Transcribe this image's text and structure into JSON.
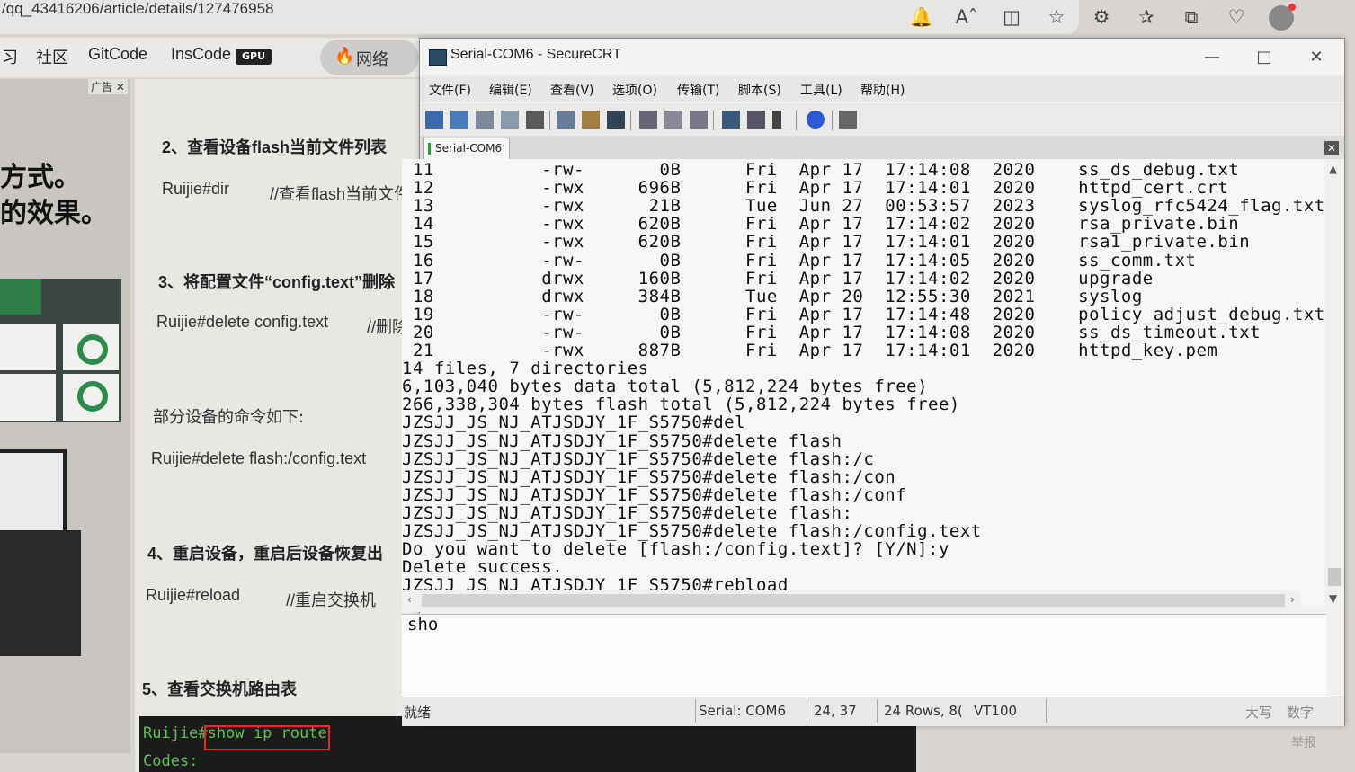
{
  "browser": {
    "url": "/qq_43416206/article/details/127476958",
    "icons": [
      "bell-icon",
      "read-aloud-icon",
      "split-screen-icon",
      "star-icon",
      "extensions-icon",
      "favorites-icon",
      "collections-icon",
      "health-icon",
      "profile-icon"
    ]
  },
  "nav": {
    "items": [
      "习",
      "社区",
      "GitCode",
      "InsCode"
    ],
    "gpu_badge": "GPU",
    "network": "网络"
  },
  "ad": {
    "tag": "广告",
    "close": "✕",
    "line1": "方式。",
    "line2": "的效果。"
  },
  "article": {
    "h2": "2、查看设备flash当前文件列表",
    "cmd_dir": "Ruijie#dir",
    "cmd_dir_comment": "//查看flash当前文件",
    "h3": "3、将配置文件“config.text”删除",
    "cmd_delete": "Ruijie#delete config.text",
    "cmd_delete_comment": "//删除",
    "note": "部分设备的命令如下:",
    "cmd_delete_flash": "Ruijie#delete flash:/config.text",
    "h4": "4、重启设备，重启后设备恢复出",
    "cmd_reload": "Ruijie#reload",
    "cmd_reload_comment": "//重启交换机",
    "h5": "5、查看交换机路由表",
    "code_prompt": "Ruijie#",
    "code_cmd": "show ip route",
    "code_line2": "Codes:"
  },
  "crt": {
    "title": "Serial-COM6 - SecureCRT",
    "menu": [
      "文件(F)",
      "编辑(E)",
      "查看(V)",
      "选项(O)",
      "传输(T)",
      "脚本(S)",
      "工具(L)",
      "帮助(H)"
    ],
    "tab": "Serial-COM6",
    "terminal_lines": [
      " 11          -rw-       0B      Fri  Apr 17  17:14:08  2020    ss_ds_debug.txt",
      " 12          -rwx     696B      Fri  Apr 17  17:14:01  2020    httpd_cert.crt",
      " 13          -rwx      21B      Tue  Jun 27  00:53:57  2023    syslog_rfc5424_flag.txt",
      " 14          -rwx     620B      Fri  Apr 17  17:14:02  2020    rsa_private.bin",
      " 15          -rwx     620B      Fri  Apr 17  17:14:01  2020    rsa1_private.bin",
      " 16          -rw-       0B      Fri  Apr 17  17:14:05  2020    ss_comm.txt",
      " 17          drwx     160B      Fri  Apr 17  17:14:02  2020    upgrade",
      " 18          drwx     384B      Tue  Apr 20  12:55:30  2021    syslog",
      " 19          -rw-       0B      Fri  Apr 17  17:14:48  2020    policy_adjust_debug.txt",
      " 20          -rw-       0B      Fri  Apr 17  17:14:08  2020    ss_ds_timeout.txt",
      " 21          -rwx     887B      Fri  Apr 17  17:14:01  2020    httpd_key.pem",
      "14 files, 7 directories",
      "6,103,040 bytes data total (5,812,224 bytes free)",
      "266,338,304 bytes flash total (5,812,224 bytes free)",
      "JZSJJ_JS_NJ_ATJSDJY_1F_S5750#del",
      "JZSJJ_JS_NJ_ATJSDJY_1F_S5750#delete flash",
      "JZSJJ_JS_NJ_ATJSDJY_1F_S5750#delete flash:/c",
      "JZSJJ_JS_NJ_ATJSDJY_1F_S5750#delete flash:/con",
      "JZSJJ_JS_NJ_ATJSDJY_1F_S5750#delete flash:/conf",
      "JZSJJ_JS_NJ_ATJSDJY_1F_S5750#delete flash:",
      "JZSJJ_JS_NJ_ATJSDJY_1F_S5750#delete flash:/config.text",
      "Do you want to delete [flash:/config.text]? [Y/N]:y",
      "Delete success.",
      "JZSJJ_JS_NJ_ATJSDJY_1F_S5750#rebload"
    ],
    "command_input": "sho",
    "status": {
      "ready": "就绪",
      "serial": "Serial: COM6",
      "cursor": "24,  37",
      "size": "24 Rows,  8(",
      "emulation": "VT100",
      "caps": "大写",
      "num": "数字"
    }
  },
  "report": "举报"
}
